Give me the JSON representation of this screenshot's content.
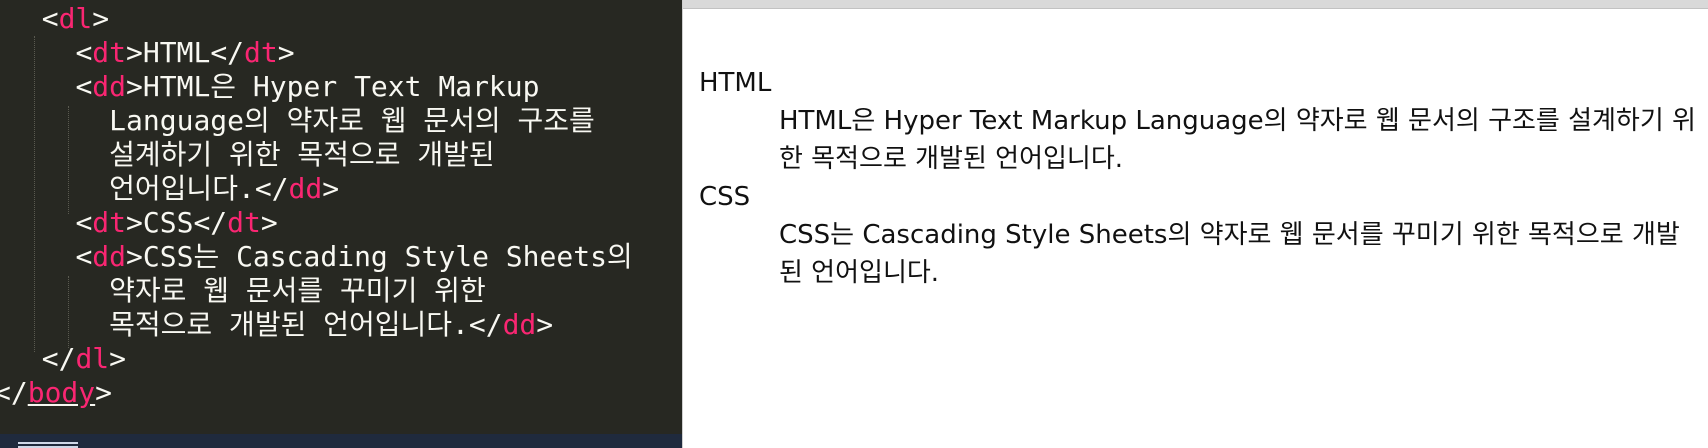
{
  "editor": {
    "lines": [
      {
        "pre": "  ",
        "open": "<",
        "tag": "dl",
        "close": ">",
        "text": ""
      },
      {
        "pre": "    ",
        "open": "<",
        "tag": "dt",
        "close": ">",
        "text": "HTML",
        "end_open": "</",
        "end_tag": "dt",
        "end_close": ">"
      },
      {
        "pre": "    ",
        "open": "<",
        "tag": "dd",
        "close": ">",
        "text": "HTML은 Hyper Text Markup"
      },
      {
        "pre": "      ",
        "text": "Language의 약자로 웹 문서의 구조를"
      },
      {
        "pre": "      ",
        "text": "설계하기 위한 목적으로 개발된"
      },
      {
        "pre": "      ",
        "text": "언어입니다.",
        "end_open": "</",
        "end_tag": "dd",
        "end_close": ">"
      },
      {
        "pre": "    ",
        "open": "<",
        "tag": "dt",
        "close": ">",
        "text": "CSS",
        "end_open": "</",
        "end_tag": "dt",
        "end_close": ">"
      },
      {
        "pre": "    ",
        "open": "<",
        "tag": "dd",
        "close": ">",
        "text": "CSS는 Cascading Style Sheets의"
      },
      {
        "pre": "      ",
        "text": "약자로 웹 문서를 꾸미기 위한"
      },
      {
        "pre": "      ",
        "text": "목적으로 개발된 언어입니다.",
        "end_open": "</",
        "end_tag": "dd",
        "end_close": ">"
      },
      {
        "pre": "  ",
        "end_open": "</",
        "end_tag": "dl",
        "end_close": ">"
      },
      {
        "pre": "",
        "end_open": "</",
        "end_tag": "body",
        "end_close": ">"
      }
    ]
  },
  "preview": {
    "items": [
      {
        "term": "HTML",
        "definition": "HTML은 Hyper Text Markup Language의 약자로 웹 문서의 구조를 설계하기 위한 목적으로 개발된 언어입니다."
      },
      {
        "term": "CSS",
        "definition": "CSS는 Cascading Style Sheets의 약자로 웹 문서를 꾸미기 위한 목적으로 개발된 언어입니다."
      }
    ]
  },
  "colors": {
    "editor_bg": "#272822",
    "tag": "#f92672",
    "code_text": "#f8f8f2",
    "preview_bg": "#ffffff"
  }
}
